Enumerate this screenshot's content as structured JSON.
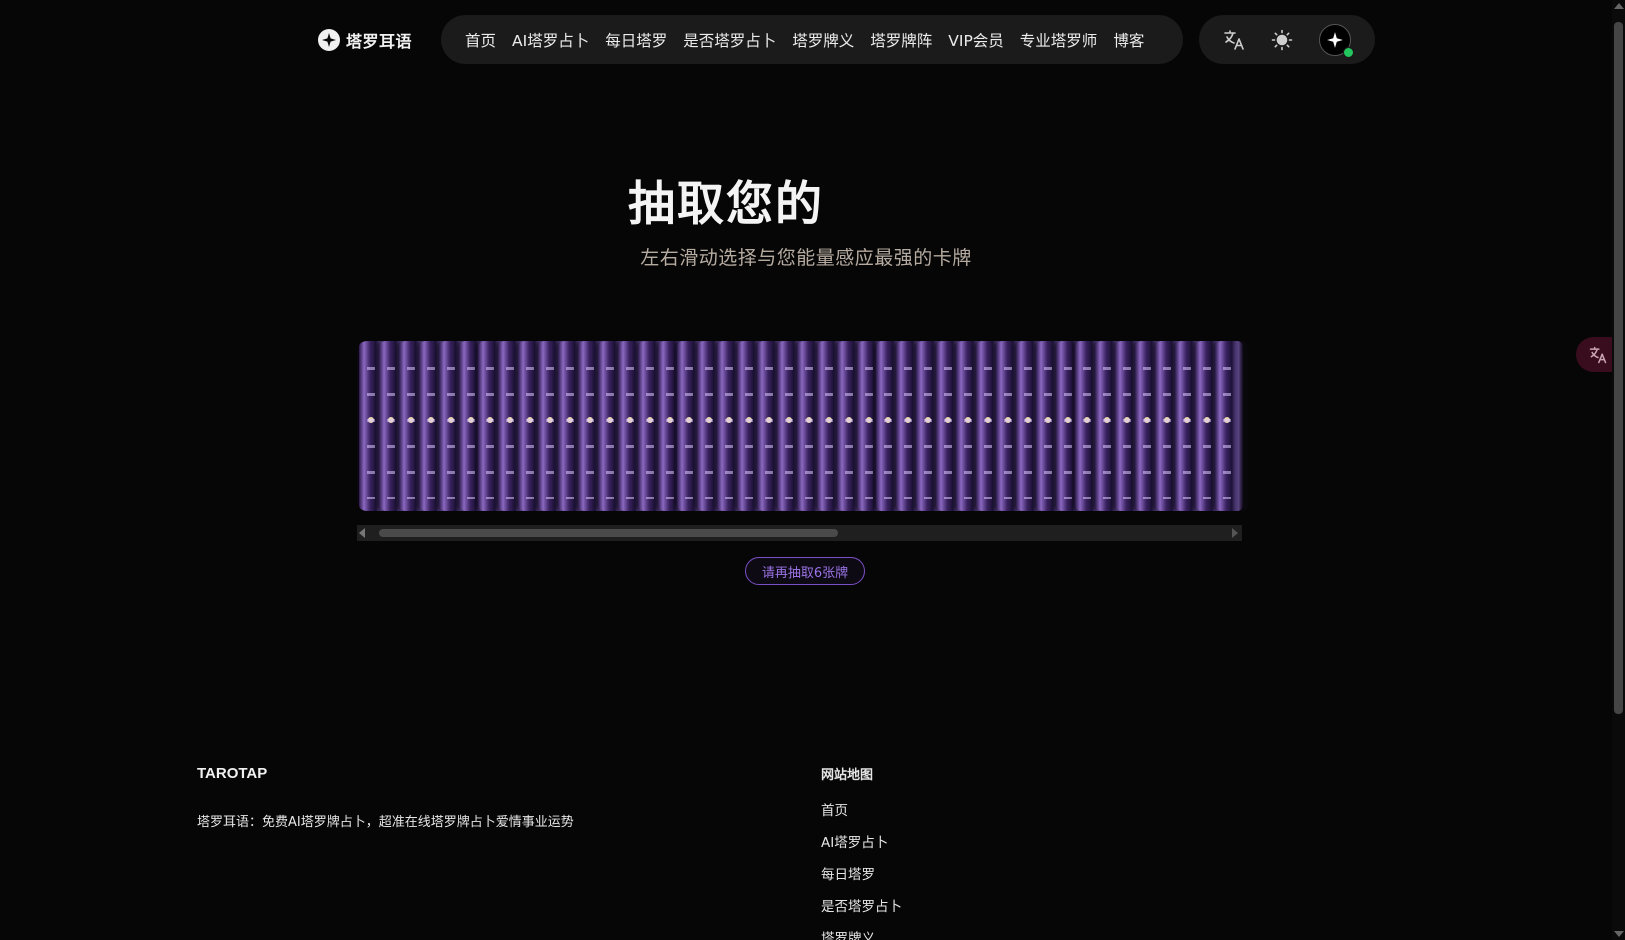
{
  "header": {
    "logo_text": "塔罗耳语",
    "nav": [
      "首页",
      "AI塔罗占卜",
      "每日塔罗",
      "是否塔罗占卜",
      "塔罗牌义",
      "塔罗牌阵",
      "VIP会员",
      "专业塔罗师",
      "博客"
    ],
    "icons": {
      "translate": "translate-icon",
      "theme": "sun-icon",
      "ai": "sparkle-icon"
    },
    "status_color": "#22c55e"
  },
  "hero": {
    "title": "抽取您的",
    "subtitle": "左右滑动选择与您能量感应最强的卡牌"
  },
  "deck": {
    "card_count": 44,
    "scroll_position": 0.52,
    "accent": "#7b4fc7"
  },
  "draw_pill": {
    "label": "请再抽取6张牌"
  },
  "footer": {
    "brand": "TAROTAP",
    "tagline": "塔罗耳语：免费AI塔罗牌占卜，超准在线塔罗牌占卜爱情事业运势",
    "sitemap_title": "网站地图",
    "sitemap_links": [
      "首页",
      "AI塔罗占卜",
      "每日塔罗",
      "是否塔罗占卜",
      "塔罗牌义"
    ]
  }
}
